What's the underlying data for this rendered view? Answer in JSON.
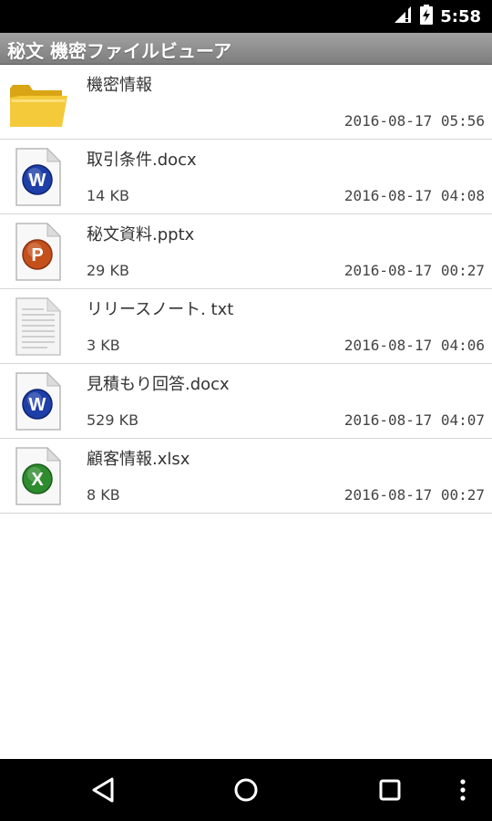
{
  "status_bar": {
    "time": "5:58",
    "icons": [
      "signal-icon",
      "battery-icon"
    ]
  },
  "app": {
    "title": "秘文 機密ファイルビューア"
  },
  "files": [
    {
      "name": "機密情報",
      "size": "",
      "date": "2016-08-17 05:56",
      "type": "folder",
      "icon": "folder-icon"
    },
    {
      "name": "取引条件.docx",
      "size": "14 KB",
      "date": "2016-08-17 04:08",
      "type": "word",
      "icon": "word-doc-icon",
      "letter": "W"
    },
    {
      "name": "秘文資料.pptx",
      "size": "29 KB",
      "date": "2016-08-17 00:27",
      "type": "powerpoint",
      "icon": "powerpoint-doc-icon",
      "letter": "P"
    },
    {
      "name": "リリースノート. txt",
      "size": "3 KB",
      "date": "2016-08-17 04:06",
      "type": "text",
      "icon": "text-doc-icon"
    },
    {
      "name": "見積もり回答.docx",
      "size": "529 KB",
      "date": "2016-08-17 04:07",
      "type": "word",
      "icon": "word-doc-icon",
      "letter": "W"
    },
    {
      "name": "顧客情報.xlsx",
      "size": "8 KB",
      "date": "2016-08-17 00:27",
      "type": "excel",
      "icon": "excel-doc-icon",
      "letter": "X"
    }
  ],
  "nav_bar": {
    "buttons": [
      "back-icon",
      "home-icon",
      "recents-icon",
      "overflow-menu-icon"
    ]
  },
  "colors": {
    "word": "#1f3fa8",
    "powerpoint": "#c4501c",
    "excel": "#2e8b2e",
    "folder": "#f2c12e",
    "title_bar": "#8f8f8f"
  }
}
